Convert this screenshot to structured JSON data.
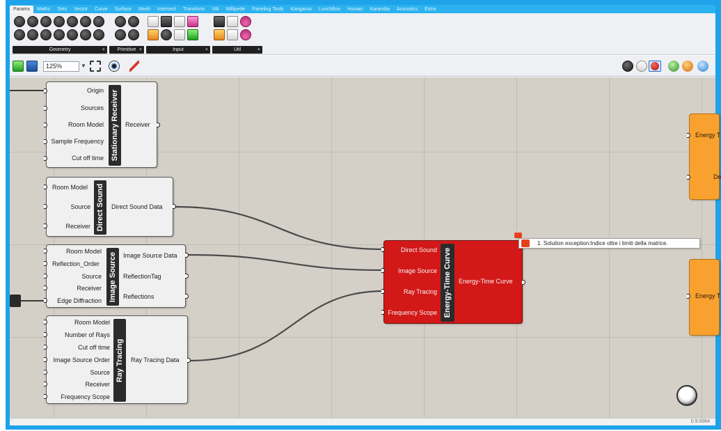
{
  "tabs": [
    "Params",
    "Maths",
    "Sets",
    "Vector",
    "Curve",
    "Surface",
    "Mesh",
    "Intersect",
    "Transform",
    "Vib",
    "Millipede",
    "Paneling Tools",
    "Kangaroo",
    "LunchBox",
    "Human",
    "Karamba",
    "Acoustics",
    "Extra"
  ],
  "active_tab": "Params",
  "ribbon_groups": [
    {
      "label": "Geometry",
      "icons": [
        "circle-x-icon",
        "geometry-ring-icon",
        "geometry-ring-icon",
        "geometry-ring-icon",
        "geometry-ring-icon",
        "geometry-ring-icon",
        "geometry-ring-icon",
        "geometry-ring-icon",
        "geometry-ring-icon",
        "geometry-ring-icon",
        "geometry-ring-icon",
        "geometry-ring-icon",
        "geometry-ring-icon",
        "geometry-ring-icon"
      ]
    },
    {
      "label": "Primitive",
      "icons": [
        "primitive-icon",
        "primitive-icon",
        "primitive-icon",
        "primitive-icon"
      ]
    },
    {
      "label": "Input",
      "icons": [
        "download-icon",
        "switch-icon",
        "slider-icon",
        "gradient-icon",
        "panel-icon",
        "knob-icon",
        "button-icon",
        "table-icon",
        "wheel-icon",
        "toggle-icon",
        "palette-icon",
        "graph-icon"
      ]
    },
    {
      "label": "Util",
      "icons": [
        "cluster-icon",
        "panel-light-icon",
        "flask-icon",
        "folder-icon",
        "abc-icon",
        "flask-icon"
      ]
    }
  ],
  "toolbar": {
    "zoom": "125%",
    "left_icons": [
      "open-file-icon",
      "save-icon",
      "zoom-extents-icon",
      "eye-icon",
      "sketch-pen-icon"
    ],
    "right_icons": [
      "preview-shaded-icon",
      "preview-wire-icon",
      "preview-red-icon",
      "preview-green-icon",
      "preview-orange-icon",
      "preview-blue-icon"
    ]
  },
  "components": {
    "stationary_receiver": {
      "title": "Stationary Receiver",
      "inputs": [
        "Origin",
        "Sources",
        "Room Model",
        "Sample Frequency",
        "Cut off time"
      ],
      "outputs": [
        "Receiver"
      ]
    },
    "direct_sound": {
      "title": "Direct Sound",
      "inputs": [
        "Room Model",
        "Source",
        "Receiver"
      ],
      "outputs": [
        "Direct Sound Data"
      ]
    },
    "image_source": {
      "title": "Image Source",
      "inputs": [
        "Room Model",
        "Reflection_Order",
        "Source",
        "Receiver",
        "Edge Diffraction"
      ],
      "outputs": [
        "Image Source Data",
        "ReflectionTag",
        "Reflections"
      ]
    },
    "ray_tracing": {
      "title": "Ray Tracing",
      "inputs": [
        "Room Model",
        "Number of Rays",
        "Cut off time",
        "Image Source Order",
        "Source",
        "Receiver",
        "Frequency Scope"
      ],
      "outputs": [
        "Ray Tracing Data"
      ]
    },
    "energy_time_curve": {
      "title": "Energy-Time Curve",
      "inputs": [
        "Direct Sound",
        "Image Source",
        "Ray Tracing",
        "Frequency Scope"
      ],
      "outputs": [
        "Energy-Time Curve"
      ],
      "error": "1. Solution exception:Indice oltre i limiti della matrice."
    },
    "orange_top": {
      "inputs": [
        "Energy T",
        "De"
      ]
    },
    "orange_bottom": {
      "inputs": [
        "Energy T"
      ]
    }
  },
  "status": {
    "left": "-",
    "version": "0.9.0064"
  },
  "colors": {
    "canvas": "#d4d0c8",
    "error_component": "#d31818",
    "cluster_component": "#f9a12f",
    "frame": "#1ea3ea"
  }
}
